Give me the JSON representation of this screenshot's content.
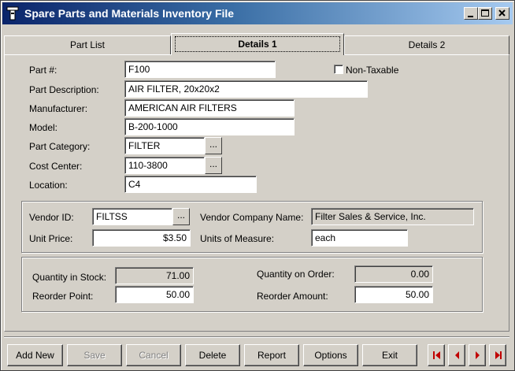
{
  "window": {
    "title": "Spare Parts and Materials Inventory File"
  },
  "tabs": [
    {
      "label": "Part List"
    },
    {
      "label": "Details 1"
    },
    {
      "label": "Details 2"
    }
  ],
  "part": {
    "part_no_label": "Part #:",
    "part_no": "F100",
    "non_taxable_label": "Non-Taxable",
    "non_taxable": false,
    "description_label": "Part Description:",
    "description": "AIR FILTER, 20x20x2",
    "manufacturer_label": "Manufacturer:",
    "manufacturer": "AMERICAN AIR FILTERS",
    "model_label": "Model:",
    "model": "B-200-1000",
    "category_label": "Part Category:",
    "category": "FILTER",
    "cost_center_label": "Cost Center:",
    "cost_center": "110-3800",
    "location_label": "Location:",
    "location": "C4"
  },
  "vendor": {
    "vendor_id_label": "Vendor ID:",
    "vendor_id": "FILTSS",
    "company_label": "Vendor Company Name:",
    "company": "Filter Sales & Service, Inc.",
    "unit_price_label": "Unit Price:",
    "unit_price": "$3.50",
    "uom_label": "Units of Measure:",
    "uom": "each"
  },
  "stock": {
    "qty_in_stock_label": "Quantity in Stock:",
    "qty_in_stock": "71.00",
    "qty_on_order_label": "Quantity on Order:",
    "qty_on_order": "0.00",
    "reorder_point_label": "Reorder Point:",
    "reorder_point": "50.00",
    "reorder_amount_label": "Reorder Amount:",
    "reorder_amount": "50.00"
  },
  "buttons": {
    "add_new": "Add New",
    "save": "Save",
    "cancel": "Cancel",
    "delete": "Delete",
    "report": "Report",
    "options": "Options",
    "exit": "Exit",
    "ellipsis": "..."
  },
  "colors": {
    "nav_arrow": "#c00000",
    "title_start": "#0a246a",
    "title_end": "#a6caf0"
  },
  "icons": [
    "app-icon",
    "minimize-icon",
    "maximize-icon",
    "close-icon",
    "first-record-icon",
    "previous-record-icon",
    "next-record-icon",
    "last-record-icon"
  ]
}
